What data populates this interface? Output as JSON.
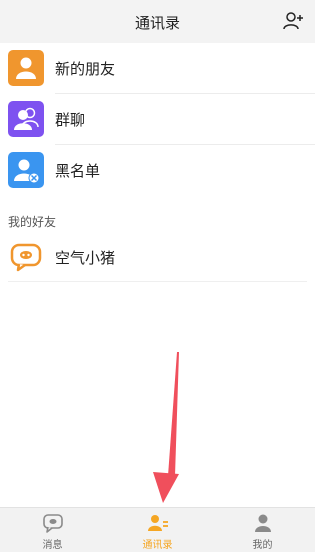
{
  "header": {
    "title": "通讯录"
  },
  "menu": [
    {
      "label": "新的朋友",
      "color": "#f0962e"
    },
    {
      "label": "群聊",
      "color": "#7e52f0"
    },
    {
      "label": "黑名单",
      "color": "#3a95f0"
    }
  ],
  "section_title": "我的好友",
  "friends": [
    {
      "name": "空气小猪"
    }
  ],
  "tabs": [
    {
      "label": "消息",
      "active": false
    },
    {
      "label": "通讯录",
      "active": true
    },
    {
      "label": "我的",
      "active": false
    }
  ],
  "colors": {
    "accent": "#f5a623",
    "annotation_arrow": "#f04f5c"
  }
}
